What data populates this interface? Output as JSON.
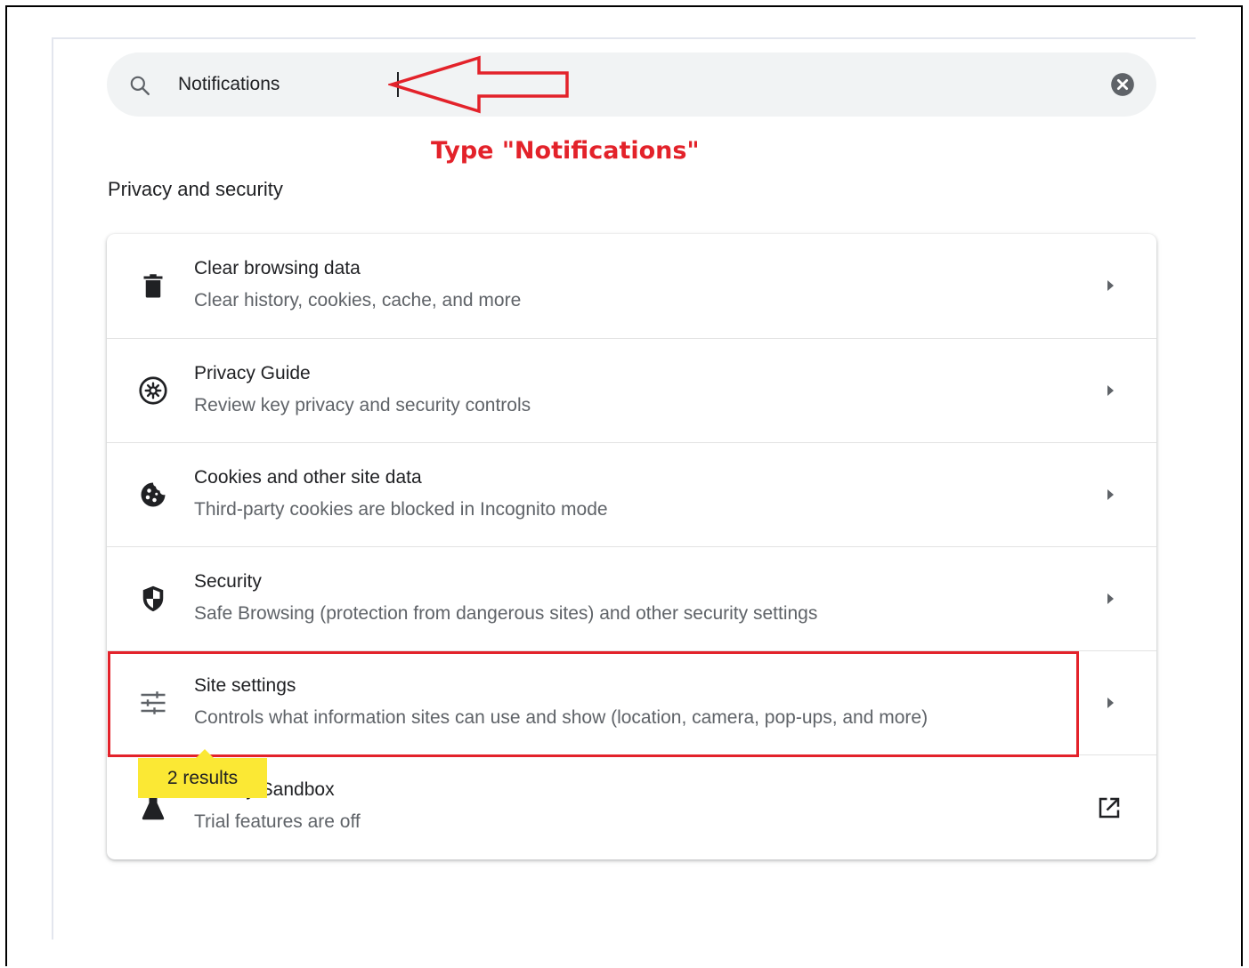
{
  "search": {
    "value": "Notifications",
    "icon": "search-icon",
    "clear_icon": "close-circle-icon"
  },
  "annotation": {
    "instruction": "Type \"Notifications\"",
    "arrow_color": "#e3222a",
    "tooltip": "2 results",
    "tooltip_color": "#fbe834"
  },
  "section": {
    "title": "Privacy and security"
  },
  "rows": [
    {
      "title": "Clear browsing data",
      "subtitle": "Clear history, cookies, cache, and more",
      "icon": "trash-icon",
      "action": "chevron-right-icon"
    },
    {
      "title": "Privacy Guide",
      "subtitle": "Review key privacy and security controls",
      "icon": "privacy-guide-icon",
      "action": "chevron-right-icon"
    },
    {
      "title": "Cookies and other site data",
      "subtitle": "Third-party cookies are blocked in Incognito mode",
      "icon": "cookie-icon",
      "action": "chevron-right-icon"
    },
    {
      "title": "Security",
      "subtitle": "Safe Browsing (protection from dangerous sites) and other security settings",
      "icon": "shield-icon",
      "action": "chevron-right-icon"
    },
    {
      "title": "Site settings",
      "subtitle": "Controls what information sites can use and show (location, camera, pop-ups, and more)",
      "icon": "tune-icon",
      "action": "chevron-right-icon"
    },
    {
      "title": "Privacy Sandbox",
      "subtitle": "Trial features are off",
      "icon": "flask-icon",
      "action": "open-in-new-icon"
    }
  ]
}
